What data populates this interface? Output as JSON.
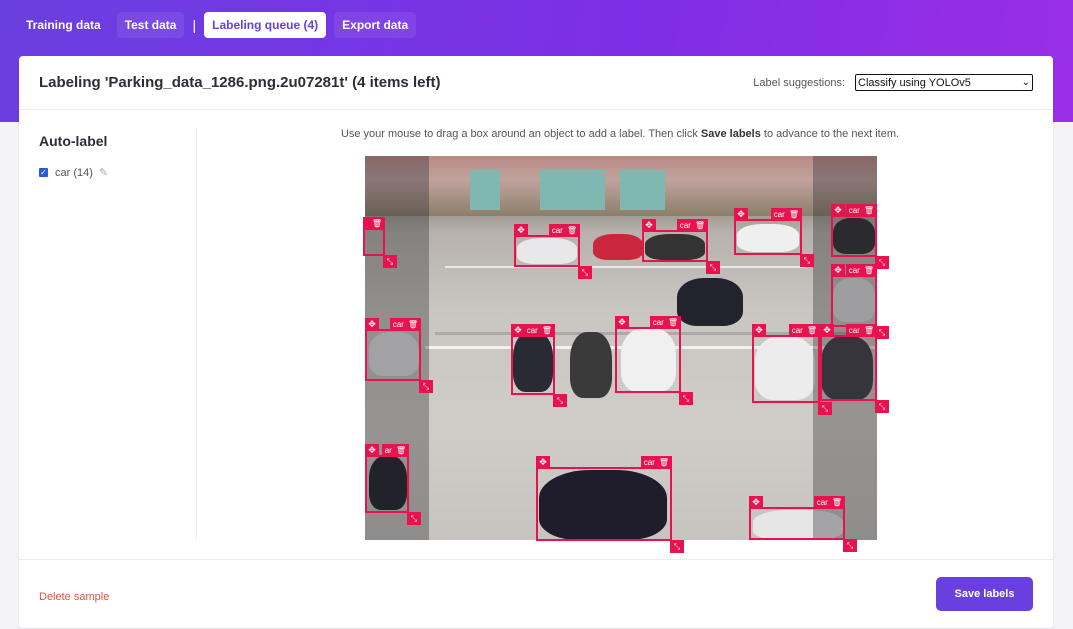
{
  "tabs": [
    {
      "label": "Training data"
    },
    {
      "label": "Test data"
    },
    {
      "label": "Labeling queue (4)"
    },
    {
      "label": "Export data"
    }
  ],
  "header": {
    "title": "Labeling 'Parking_data_1286.png.2u07281t' (4 items left)",
    "suggestions_label": "Label suggestions:",
    "suggestions_value": "Classify using YOLOv5"
  },
  "sidebar": {
    "title": "Auto-label",
    "items": [
      {
        "label": "car (14)",
        "checked": true
      }
    ]
  },
  "instructions": {
    "before": "Use your mouse to drag a box around an object to add a label. Then click ",
    "bold": "Save labels",
    "after": " to advance to the next item."
  },
  "boxes": [
    {
      "label": ""
    },
    {
      "label": "car"
    },
    {
      "label": "car"
    },
    {
      "label": "car"
    },
    {
      "label": "car"
    },
    {
      "label": "car"
    },
    {
      "label": "car"
    },
    {
      "label": "car"
    },
    {
      "label": "car"
    },
    {
      "label": "car"
    },
    {
      "label": "car"
    },
    {
      "label": "ar"
    },
    {
      "label": "car"
    },
    {
      "label": "car"
    }
  ],
  "footer": {
    "delete_label": "Delete sample",
    "save_label": "Save labels"
  },
  "colors": {
    "accent": "#6a3fe0",
    "box": "#e8134e",
    "danger": "#e0533f"
  }
}
